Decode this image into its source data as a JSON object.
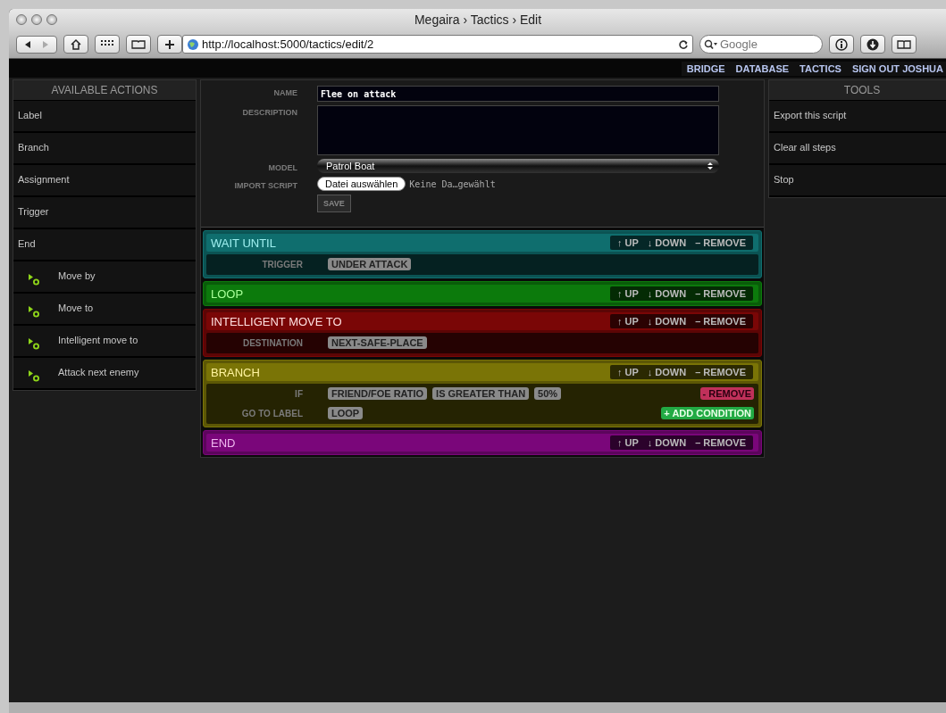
{
  "window": {
    "title": "Megaira › Tactics › Edit"
  },
  "toolbar": {
    "url": "http://localhost:5000/tactics/edit/2",
    "search": {
      "placeholder": "Google"
    }
  },
  "nav": [
    "BRIDGE",
    "DATABASE",
    "TACTICS",
    "SIGN OUT JOSHUA"
  ],
  "actions": {
    "title": "AVAILABLE ACTIONS",
    "items": [
      {
        "label": "Label",
        "kind": "plain"
      },
      {
        "label": "Branch",
        "kind": "plain"
      },
      {
        "label": "Assignment",
        "kind": "plain"
      },
      {
        "label": "Trigger",
        "kind": "plain"
      },
      {
        "label": "End",
        "kind": "plain"
      },
      {
        "label": "Move by",
        "kind": "script"
      },
      {
        "label": "Move to",
        "kind": "script"
      },
      {
        "label": "Intelligent move to",
        "kind": "script"
      },
      {
        "label": "Attack next enemy",
        "kind": "script"
      }
    ]
  },
  "form": {
    "name": {
      "label": "NAME",
      "value": "Flee on attack"
    },
    "description": {
      "label": "DESCRIPTION"
    },
    "model": {
      "label": "MODEL",
      "value": "Patrol Boat"
    },
    "import": {
      "label": "IMPORT SCRIPT",
      "button": "Datei auswählen",
      "status": "Keine Da…gewählt"
    },
    "save": "SAVE"
  },
  "steps": [
    {
      "title": "WAIT UNTIL",
      "color": "#0f6e6e",
      "up": "↑ UP",
      "down": "↓ DOWN",
      "remove": "– REMOVE",
      "rows": [
        {
          "label": "TRIGGER",
          "tokens": [
            "UNDER ATTACK"
          ]
        }
      ]
    },
    {
      "title": "LOOP",
      "color": "#0c7a0c",
      "up": "↑ UP",
      "down": "↓ DOWN",
      "remove": "– REMOVE"
    },
    {
      "title": "INTELLIGENT MOVE TO",
      "color": "#7a0606",
      "up": "↑ UP",
      "down": "↓ DOWN",
      "remove": "– REMOVE",
      "rows": [
        {
          "label": "DESTINATION",
          "tokens": [
            "NEXT-SAFE-PLACE"
          ]
        }
      ]
    },
    {
      "title": "BRANCH",
      "color": "#7a7406",
      "up": "↑ UP",
      "down": "↓ DOWN",
      "remove": "– REMOVE",
      "rows": [
        {
          "label": "IF",
          "tokens": [
            "FRIEND/FOE RATIO",
            "IS GREATER THAN",
            "50%"
          ],
          "action": {
            "kind": "remove",
            "label": "- REMOVE"
          }
        },
        {
          "label": "GO TO LABEL",
          "tokens": [
            "LOOP"
          ],
          "action": {
            "kind": "add",
            "label": "+ ADD CONDITION"
          }
        }
      ]
    },
    {
      "title": "END",
      "color": "#7a067a",
      "up": "↑ UP",
      "down": "↓ DOWN",
      "remove": "– REMOVE"
    }
  ],
  "tools": {
    "title": "TOOLS",
    "items": [
      "Export this script",
      "Clear all steps",
      "Stop"
    ]
  }
}
